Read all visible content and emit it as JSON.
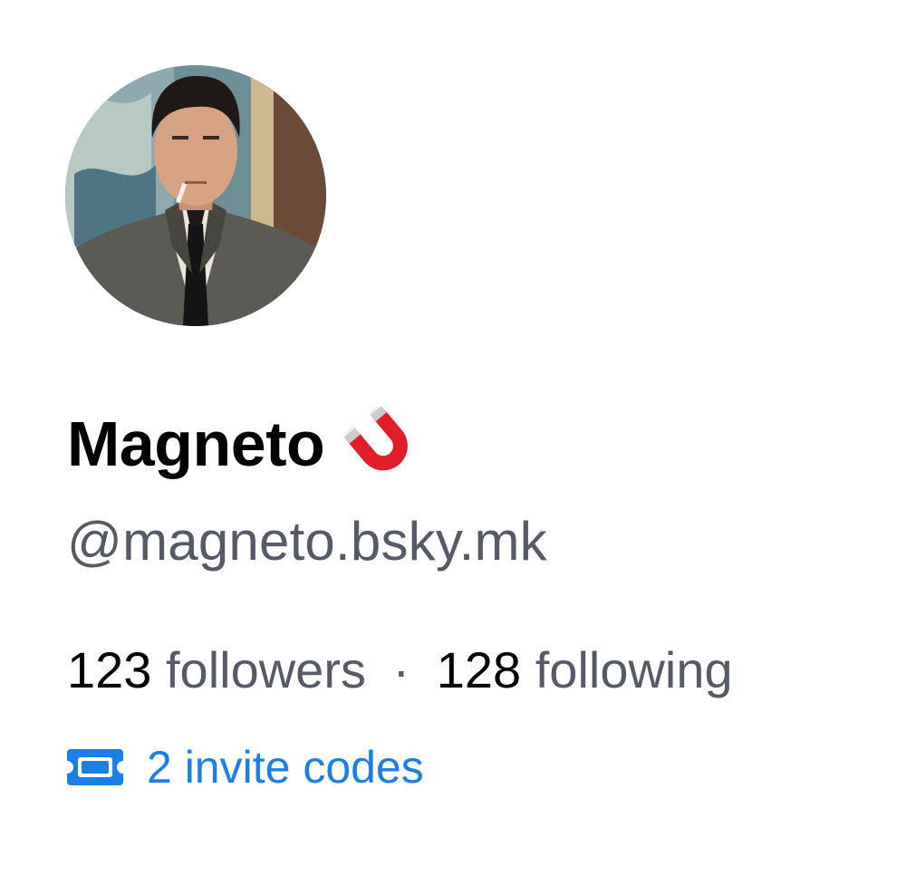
{
  "profile": {
    "display_name": "Magneto",
    "name_emoji_icon": "magnet-icon",
    "handle": "@magneto.bsky.mk",
    "avatar_icon": "avatar-photo"
  },
  "stats": {
    "followers_count": "123",
    "followers_label": "followers",
    "separator": "·",
    "following_count": "128",
    "following_label": "following"
  },
  "invite": {
    "icon": "ticket-icon",
    "label": "2 invite codes"
  },
  "colors": {
    "accent": "#1b7fe6",
    "secondary_text": "#545b66",
    "primary_text": "#000000",
    "background": "#ffffff"
  }
}
